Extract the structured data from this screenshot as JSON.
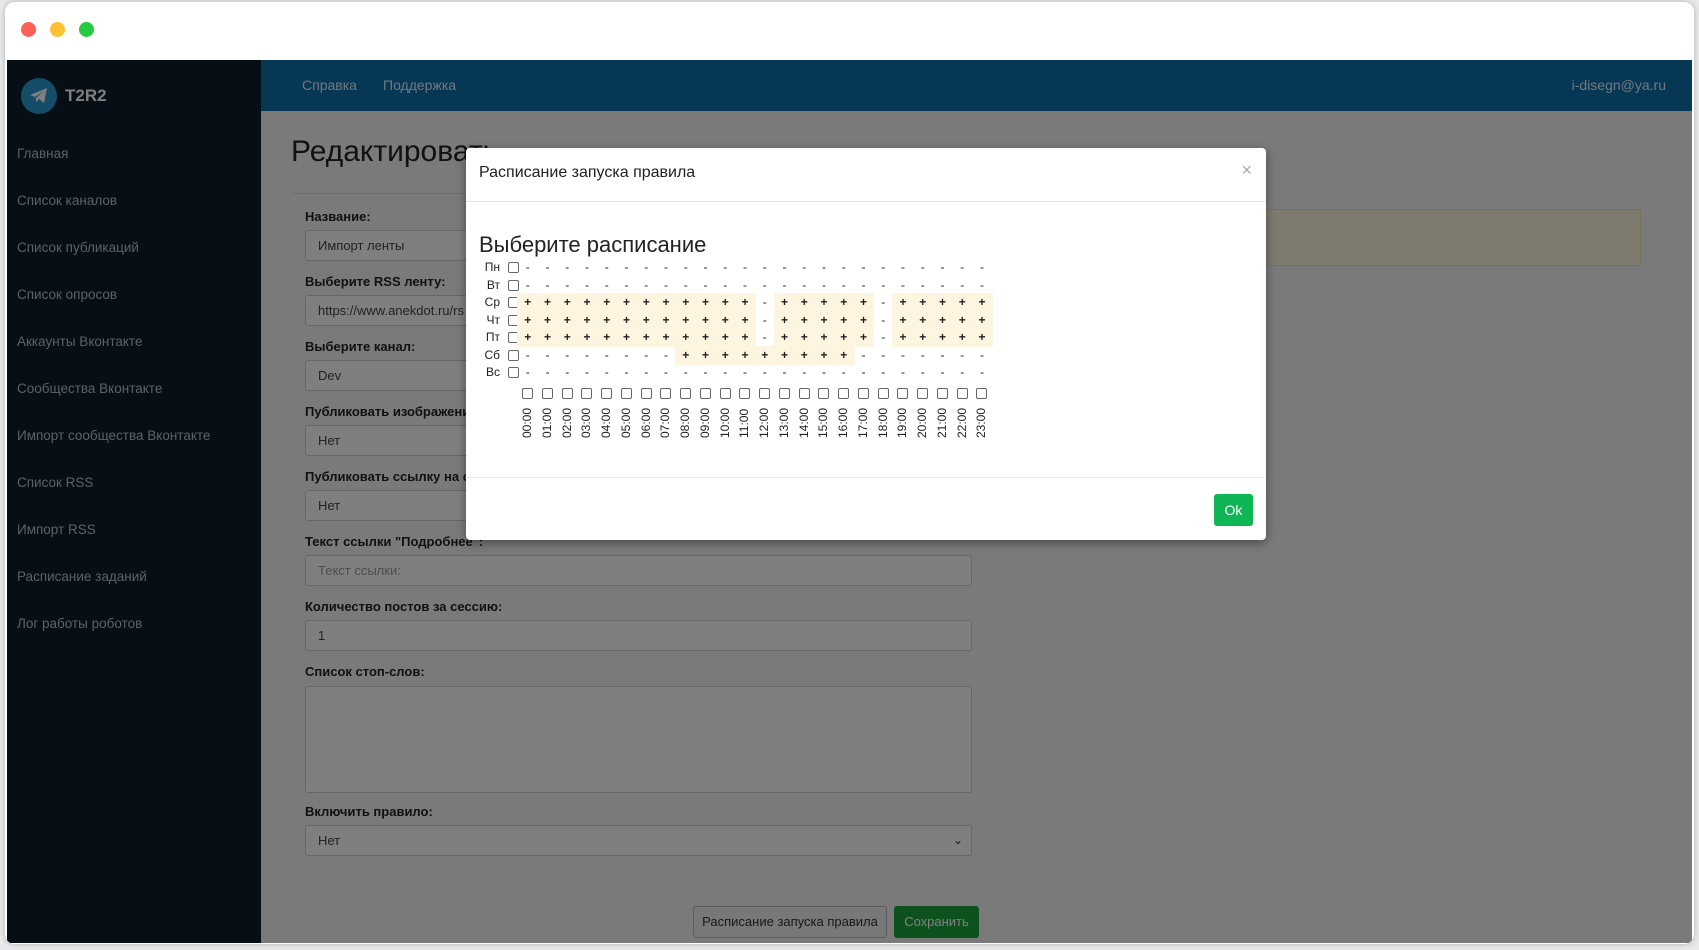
{
  "window": {
    "title": ""
  },
  "brand": {
    "name": "T2R2"
  },
  "sidebar": {
    "items": [
      {
        "label": "Главная"
      },
      {
        "label": "Список каналов"
      },
      {
        "label": "Список публикаций"
      },
      {
        "label": "Список опросов"
      },
      {
        "label": "Аккаунты Вконтакте"
      },
      {
        "label": "Сообщества Вконтакте"
      },
      {
        "label": "Импорт сообщества Вконтакте"
      },
      {
        "label": "Список RSS"
      },
      {
        "label": "Импорт RSS"
      },
      {
        "label": "Расписание заданий"
      },
      {
        "label": "Лог работы роботов"
      }
    ]
  },
  "topbar": {
    "links": [
      {
        "label": "Справка"
      },
      {
        "label": "Поддержка"
      }
    ],
    "user": "i-disegn@ya.ru"
  },
  "page": {
    "title": "Редактировать",
    "fields": {
      "name_label": "Название:",
      "name_value": "Импорт ленты",
      "rss_label": "Выберите RSS ленту:",
      "rss_value": "https://www.anekdot.ru/rs",
      "channel_label": "Выберите канал:",
      "channel_value": "Dev",
      "images_label": "Публиковать изображени",
      "images_value": "Нет",
      "link_label": "Публиковать ссылку на статью:",
      "link_value": "Нет",
      "more_label": "Текст ссылки \"Подробнее\":",
      "more_placeholder": "Текст ссылки:",
      "count_label": "Количество постов за сессию:",
      "count_value": "1",
      "stopwords_label": "Список стоп-слов:",
      "stopwords_value": "",
      "enable_label": "Включить правило:",
      "enable_value": "Нет"
    },
    "buttons": {
      "schedule": "Расписание запуска правила",
      "save": "Сохранить"
    }
  },
  "modal": {
    "title": "Расписание запуска правила",
    "close": "×",
    "heading": "Выберите расписание",
    "ok": "Ok",
    "days": [
      "Пн",
      "Вт",
      "Ср",
      "Чт",
      "Пт",
      "Сб",
      "Вс"
    ],
    "hours": [
      "00:00",
      "01:00",
      "02:00",
      "03:00",
      "04:00",
      "05:00",
      "06:00",
      "07:00",
      "08:00",
      "09:00",
      "10:00",
      "11:00",
      "12:00",
      "13:00",
      "14:00",
      "15:00",
      "16:00",
      "17:00",
      "18:00",
      "19:00",
      "20:00",
      "21:00",
      "22:00",
      "23:00"
    ],
    "schedule": [
      "------------------------",
      "------------------------",
      "++++++++++++-+++++-+++++",
      "++++++++++++-+++++-+++++",
      "++++++++++++-+++++-+++++",
      "--------+++++++++-------",
      "------------------------"
    ]
  }
}
